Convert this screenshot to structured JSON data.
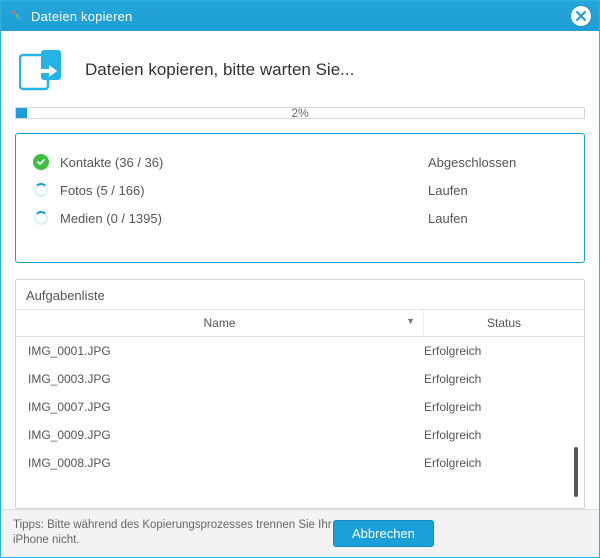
{
  "window": {
    "title": "Dateien kopieren"
  },
  "header": {
    "message": "Dateien kopieren, bitte warten Sie..."
  },
  "progress": {
    "percent": 2,
    "label": "2%"
  },
  "categories": [
    {
      "icon": "done",
      "label": "Kontakte (36 / 36)",
      "state": "Abgeschlossen"
    },
    {
      "icon": "running",
      "label": "Fotos (5 / 166)",
      "state": "Laufen"
    },
    {
      "icon": "running",
      "label": "Medien (0 / 1395)",
      "state": "Laufen"
    }
  ],
  "tasklist": {
    "title": "Aufgabenliste",
    "columns": {
      "name": "Name",
      "status": "Status"
    },
    "rows": [
      {
        "name": "IMG_0001.JPG",
        "status": "Erfolgreich"
      },
      {
        "name": "IMG_0003.JPG",
        "status": "Erfolgreich"
      },
      {
        "name": "IMG_0007.JPG",
        "status": "Erfolgreich"
      },
      {
        "name": "IMG_0009.JPG",
        "status": "Erfolgreich"
      },
      {
        "name": "IMG_0008.JPG",
        "status": "Erfolgreich"
      }
    ]
  },
  "footer": {
    "tip": "Tipps: Bitte während des Kopierungsprozesses trennen Sie Ihr iPhone nicht.",
    "cancel": "Abbrechen"
  }
}
